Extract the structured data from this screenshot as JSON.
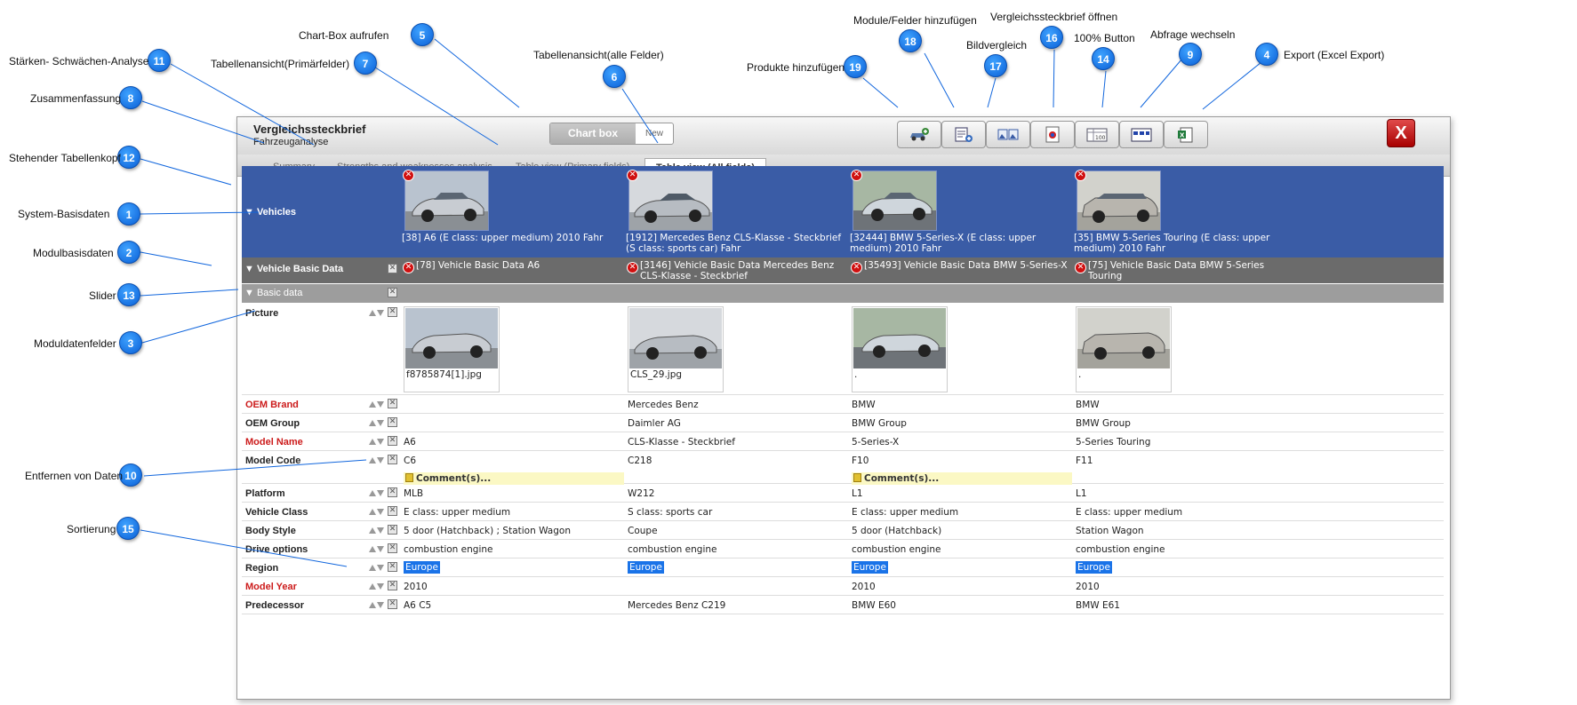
{
  "header": {
    "title": "Vergleichssteckbrief",
    "subtitle": "Fahrzeuganalyse",
    "chartbox_label": "Chart box",
    "new_label": "New",
    "close_label": "X"
  },
  "toolbar": {
    "icons": [
      "add-products-icon",
      "add-modules-icon",
      "image-compare-icon",
      "open-comparison-icon",
      "100-percent-icon",
      "switch-query-icon",
      "excel-export-icon"
    ]
  },
  "tabs": [
    {
      "label": "Summary"
    },
    {
      "label": "Strengths and weaknesses analysis"
    },
    {
      "label": "Table view (Primary fields)"
    },
    {
      "label": "Table view (All fields)"
    }
  ],
  "vehicles_label": "Vehicles",
  "vehicles": [
    {
      "caption": "[38] A6 (E class: upper medium) 2010 Fahr",
      "module": "[78] Vehicle Basic Data A6",
      "picture_caption": "f8785874[1].jpg"
    },
    {
      "caption": "[1912] Mercedes Benz CLS-Klasse - Steckbrief (S class: sports car) Fahr",
      "module": "[3146] Vehicle Basic Data Mercedes Benz CLS-Klasse - Steckbrief",
      "picture_caption": "CLS_29.jpg"
    },
    {
      "caption": "[32444] BMW 5-Series-X (E class: upper medium) 2010 Fahr",
      "module": "[35493] Vehicle Basic Data BMW 5-Series-X",
      "picture_caption": "."
    },
    {
      "caption": "[35] BMW 5-Series Touring (E class: upper medium) 2010 Fahr",
      "module": "[75] Vehicle Basic Data BMW 5-Series Touring",
      "picture_caption": "."
    }
  ],
  "module_label": "Vehicle Basic Data",
  "subsection_label": "Basic data",
  "picture_label": "Picture",
  "comment_label": "Comment(s)...",
  "rows": [
    {
      "label": "OEM Brand",
      "required": true,
      "values": [
        "",
        "Mercedes Benz",
        "BMW",
        "BMW"
      ]
    },
    {
      "label": "OEM Group",
      "required": false,
      "values": [
        "",
        "Daimler AG",
        "BMW Group",
        "BMW Group"
      ]
    },
    {
      "label": "Model Name",
      "required": true,
      "values": [
        "A6",
        "CLS-Klasse - Steckbrief",
        "5-Series-X",
        "5-Series Touring"
      ]
    },
    {
      "label": "Model Code",
      "required": false,
      "values": [
        "C6",
        "C218",
        "F10",
        "F11"
      ]
    },
    {
      "label": "Platform",
      "required": false,
      "values": [
        "MLB",
        "W212",
        "L1",
        "L1"
      ]
    },
    {
      "label": "Vehicle Class",
      "required": false,
      "values": [
        "E class: upper medium",
        "S class: sports car",
        "E class: upper medium",
        "E class: upper medium"
      ]
    },
    {
      "label": "Body Style",
      "required": false,
      "values": [
        "5 door (Hatchback) ; Station Wagon",
        "Coupe",
        "5 door (Hatchback)",
        "Station Wagon"
      ]
    },
    {
      "label": "Drive options",
      "required": false,
      "values": [
        "combustion engine",
        "combustion engine",
        "combustion engine",
        "combustion engine"
      ]
    },
    {
      "label": "Region",
      "required": false,
      "values": [
        "Europe",
        "Europe",
        "Europe",
        "Europe"
      ]
    },
    {
      "label": "Model Year",
      "required": true,
      "values": [
        "2010",
        "",
        "2010",
        "2010"
      ]
    },
    {
      "label": "Predecessor",
      "required": false,
      "values": [
        "A6 C5",
        "Mercedes Benz C219",
        "BMW E60",
        "BMW E61"
      ]
    }
  ],
  "callouts": [
    {
      "num": "1",
      "label": "System-Basisdaten"
    },
    {
      "num": "2",
      "label": "Modulbasisdaten"
    },
    {
      "num": "3",
      "label": "Moduldatenfelder"
    },
    {
      "num": "4",
      "label": "Export (Excel Export)"
    },
    {
      "num": "5",
      "label": "Chart-Box aufrufen"
    },
    {
      "num": "6",
      "label": "Tabellenansicht(alle Felder)"
    },
    {
      "num": "7",
      "label": "Tabellenansicht(Primärfelder)"
    },
    {
      "num": "8",
      "label": "Zusammenfassung"
    },
    {
      "num": "9",
      "label": "Abfrage wechseln"
    },
    {
      "num": "10",
      "label": "Entfernen von Daten"
    },
    {
      "num": "11",
      "label": "Stärken- Schwächen-Analyse"
    },
    {
      "num": "12",
      "label": "Stehender Tabellenkopf"
    },
    {
      "num": "13",
      "label": "Slider"
    },
    {
      "num": "14",
      "label": "100% Button"
    },
    {
      "num": "15",
      "label": "Sortierung"
    },
    {
      "num": "16",
      "label": "Vergleichssteckbrief öffnen"
    },
    {
      "num": "17",
      "label": "Bildvergleich"
    },
    {
      "num": "18",
      "label": "Module/Felder hinzufügen"
    },
    {
      "num": "19",
      "label": "Produkte hinzufügen"
    }
  ]
}
